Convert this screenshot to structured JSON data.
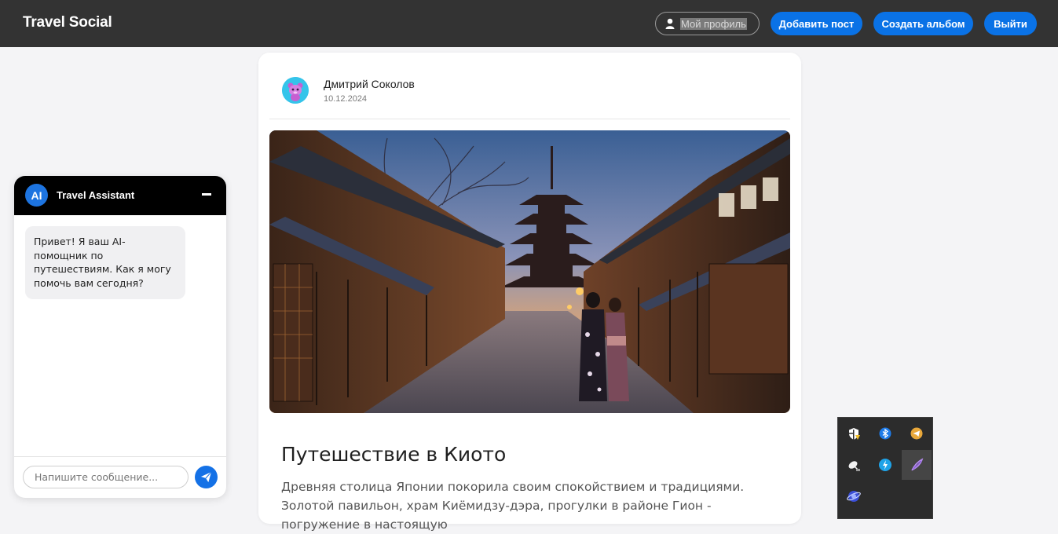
{
  "header": {
    "brand": "Travel Social",
    "profile_label": "Мой профиль",
    "add_post_label": "Добавить пост",
    "create_album_label": "Создать альбом",
    "logout_label": "Выйти",
    "accent_color": "#0a72e6"
  },
  "post": {
    "author": "Дмитрий Соколов",
    "date": "10.12.2024",
    "title": "Путешествие в Киото",
    "text": "Древняя столица Японии покорила своим спокойствием и традициями. Золотой павильон, храм Киёмидзу-дэра, прогулки в районе Гион - погружение в настоящую"
  },
  "chat": {
    "badge": "AI",
    "title": "Travel Assistant",
    "greeting": "Привет! Я ваш AI-помощник по путешествиям. Как я могу помочь вам сегодня?",
    "input_placeholder": "Напишите сообщение..."
  },
  "tray": {
    "icons": [
      "shield-warning-icon",
      "bluetooth-icon",
      "telegram-icon",
      "satellite-dish-icon",
      "sync-icon",
      "feather-icon",
      "vpn-globe-icon"
    ]
  }
}
